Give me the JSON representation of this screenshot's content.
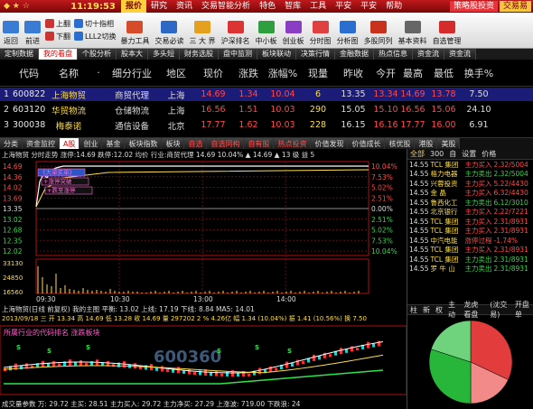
{
  "titlebar": {
    "clock": "11:19:53",
    "menu": [
      "报价",
      "研究",
      "资讯",
      "交易智能分析",
      "特色",
      "智库",
      "工具",
      "平安",
      "平安",
      "帮助"
    ],
    "active_menu": 0,
    "tags": [
      "策略股投资",
      "交易易"
    ]
  },
  "toolbar": {
    "nav_items": [
      {
        "label": "返回",
        "icon": "back-icon",
        "color": "#3a7bd5"
      },
      {
        "label": "前进",
        "icon": "forward-icon",
        "color": "#3a7bd5"
      }
    ],
    "pair1": [
      "上翻",
      "下翻"
    ],
    "pair2": [
      "切十指相",
      "LLL2切换"
    ],
    "items": [
      {
        "label": "暴力工具",
        "icon": "tool-icon",
        "color": "#d64c2a"
      },
      {
        "label": "交易必读",
        "icon": "book-icon",
        "color": "#2d68c4"
      },
      {
        "label": "三  大  界",
        "icon": "grid-icon",
        "color": "#e6a020"
      },
      {
        "label": "沪深排名",
        "icon": "rank-icon",
        "color": "#d33"
      },
      {
        "label": "中小板",
        "icon": "board-icon",
        "color": "#2e9e3e"
      },
      {
        "label": "创业板",
        "icon": "startup-icon",
        "color": "#8a3ec4"
      },
      {
        "label": "分时图",
        "icon": "minute-chart-icon",
        "color": "#e04040"
      },
      {
        "label": "分析图",
        "icon": "kline-icon",
        "color": "#2a6fd0"
      },
      {
        "label": "多股同列",
        "icon": "multi-stock-icon",
        "color": "#c8321c"
      },
      {
        "label": "基本资料",
        "icon": "info-icon",
        "color": "#666"
      },
      {
        "label": "自选管理",
        "icon": "favorite-icon",
        "color": "#d62b2b"
      }
    ]
  },
  "tabstrip": {
    "tabs": [
      "定制数据",
      "我的看盘",
      "个股分析",
      "股本大",
      "多头短",
      "财务选股",
      "盘中监测",
      "板块联动",
      "决策行情",
      "金融数据",
      "热点信息",
      "资金流",
      "资金流"
    ],
    "active": 1
  },
  "quote_header": [
    "代码",
    "名称",
    "·",
    "细分行业",
    "地区",
    "现价",
    "涨跌",
    "涨幅%",
    "现量",
    "昨收",
    "今开",
    "最高",
    "最低",
    "换手%"
  ],
  "quotes": [
    {
      "idx": "1",
      "code": "600822",
      "name": "上海物贸",
      "industry": "商贸代理",
      "region": "上海",
      "price": "14.69",
      "chg": "1.34",
      "pct": "10.04",
      "vol": "6",
      "prev": "13.35",
      "open": "13.34",
      "high": "14.69",
      "low": "13.78",
      "turnover": "7.50",
      "dir": "up"
    },
    {
      "idx": "2",
      "code": "603120",
      "name": "华贸物流",
      "industry": "仓储物流",
      "region": "上海",
      "price": "16.56",
      "chg": "1.51",
      "pct": "10.03",
      "vol": "290",
      "prev": "15.05",
      "open": "15.10",
      "high": "16.56",
      "low": "15.06",
      "turnover": "24.10",
      "dir": "up"
    },
    {
      "idx": "3",
      "code": "300038",
      "name": "梅泰诺",
      "industry": "通信设备",
      "region": "北京",
      "price": "17.77",
      "chg": "1.62",
      "pct": "10.03",
      "vol": "228",
      "prev": "16.15",
      "open": "16.16",
      "high": "17.77",
      "low": "16.00",
      "turnover": "6.91",
      "dir": "up"
    }
  ],
  "cattabs": {
    "tabs": [
      "分类",
      "资金监控",
      "A股",
      "创业",
      "基金",
      "板块指数",
      "板块",
      "自选",
      "自选同构",
      "自有股",
      "热点投资",
      "价值发现",
      "价值成长",
      "核优股",
      "港股",
      "美股"
    ],
    "active": 2,
    "red": [
      7,
      8,
      9,
      10
    ]
  },
  "chart": {
    "header": "上海物贸 分时走势 涨停:14.69 跌停:12.02 均价 行业:商贸代理 14.69 10.04% ▲ 14.69 ▲ 13 级 益 5",
    "yticks": [
      "14.69",
      "14.36",
      "14.02",
      "13.69",
      "13.35",
      "13.02",
      "12.68",
      "12.35",
      "12.02"
    ],
    "pct_ticks": [
      "10.04%",
      "7.53%",
      "5.02%",
      "2.51%",
      "0.00%",
      "2.51%",
      "5.02%",
      "7.53%",
      "10.04%"
    ],
    "vol_ticks": [
      "33130",
      "24850",
      "16560"
    ],
    "times": [
      "09:30",
      "10:30",
      "13:00",
      "14:00"
    ],
    "info_line1": "上海物贸(日线 前复权) 我的主图  平衡: 13.02  上线: 17.19  下线: 8.84  MA5: 14.01",
    "info_line2": "2013/09/18 三 开 13.34 高 14.69 低 13.28 收 14.69 量 297202 2 % 4.26亿 幅 1.34 (10.04%) 振 1.41 (10.56%) 换 7.50",
    "indicator_title": "所属行业的代码排名 涨跌板块",
    "bottom_line": "成交量参数 万: 29.72  主买: 28.51  主力买入: 29.72  主力净买: 27.29  上涨波: 719.00  下跌浪: 24",
    "watermark": "600360",
    "alerts": [
      "《大单买单》",
      "+涨停突破",
      "+跌至涨停"
    ]
  },
  "rightpanel": {
    "tabs": [
      "全部",
      "300",
      "自",
      "设置",
      "价格"
    ],
    "ticks": [
      {
        "t": "14.55",
        "name": "TCL 集团",
        "act": "主力买入",
        "val": "2.32/5004"
      },
      {
        "t": "14.55",
        "name": "格力电器",
        "act": "主力卖出",
        "val": "2.32/5004"
      },
      {
        "t": "14.55",
        "name": "兴蓉投资",
        "act": "主力买入",
        "val": "5.22/4430"
      },
      {
        "t": "14.55",
        "name": "金 晶",
        "act": "主力买入",
        "val": "6.32/4430"
      },
      {
        "t": "14.55",
        "name": "鲁西化工",
        "act": "主力卖出",
        "val": "6.12/3010"
      },
      {
        "t": "14.55",
        "name": "北京银行",
        "act": "主力买入",
        "val": "2.22/7221"
      },
      {
        "t": "14.55",
        "name": "TCL 集团",
        "act": "主力买入",
        "val": "2.31/8931"
      },
      {
        "t": "14.55",
        "name": "TCL 集团",
        "act": "主力买入",
        "val": "2.31/8931"
      },
      {
        "t": "14.55",
        "name": "中汽电能",
        "act": "涨停过程",
        "val": "-1.74%"
      },
      {
        "t": "14.55",
        "name": "TCL 集团",
        "act": "主力买入",
        "val": "2.31/8931"
      },
      {
        "t": "14.55",
        "name": "TCL 集团",
        "act": "主力卖出",
        "val": "2.31/8931"
      },
      {
        "t": "14.55",
        "name": "罗 牛 山",
        "act": "主力卖出",
        "val": "2.31/8931"
      }
    ],
    "subtabs": [
      "柱",
      "新",
      "权",
      "主动",
      "龙虎看盘",
      "(沈交易)",
      "开盘单"
    ],
    "pie": [
      {
        "label": "主动买",
        "value": 0.32,
        "color": "#e23c3c"
      },
      {
        "label": "被动买",
        "value": 0.18,
        "color": "#f28a8a"
      },
      {
        "label": "主动卖",
        "value": 0.3,
        "color": "#27b53a"
      },
      {
        "label": "被动卖",
        "value": 0.2,
        "color": "#6fd27c"
      }
    ]
  }
}
